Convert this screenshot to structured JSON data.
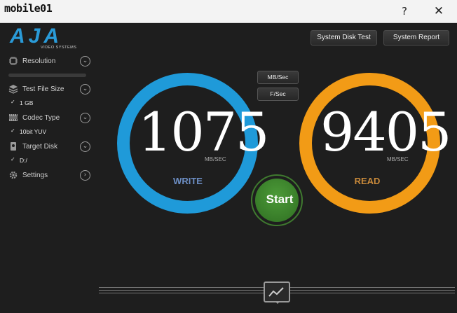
{
  "window": {
    "watermark_text": "mobile01",
    "help_label": "?",
    "close_label": "✕"
  },
  "brand": {
    "logo": "AJA",
    "sub": "VIDEO SYSTEMS"
  },
  "header": {
    "system_disk_test": "System Disk Test",
    "system_report": "System Report"
  },
  "sidebar": {
    "resolution": {
      "label": "Resolution",
      "icon": "chip-icon"
    },
    "test_file_size": {
      "label": "Test File Size",
      "value": "1 GB",
      "icon": "stack-icon"
    },
    "codec_type": {
      "label": "Codec Type",
      "value": "10bit YUV",
      "icon": "film-icon"
    },
    "target_disk": {
      "label": "Target Disk",
      "value": "D:/",
      "icon": "disk-icon"
    },
    "settings": {
      "label": "Settings",
      "icon": "gear-icon"
    }
  },
  "units": {
    "mbsec": "MB/Sec",
    "fsec": "F/Sec"
  },
  "write": {
    "value": "1075",
    "unit": "MB/SEC",
    "label": "WRITE",
    "color": "#1f9ad9"
  },
  "read": {
    "value": "9405",
    "unit": "MB/SEC",
    "label": "READ",
    "color": "#f29b16"
  },
  "start_label": "Start"
}
